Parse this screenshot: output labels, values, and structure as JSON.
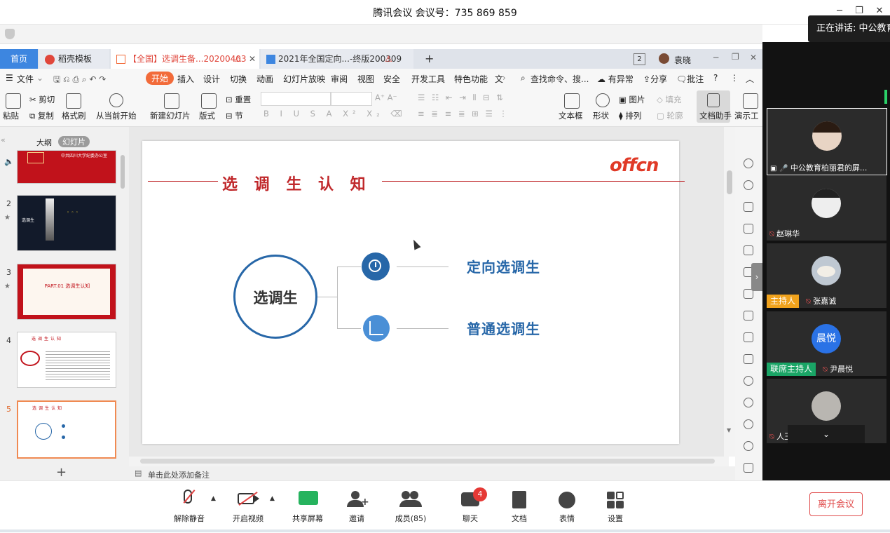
{
  "window": {
    "title": "腾讯会议 会议号：735 869 859",
    "speaking": "正在讲话: 中公教育钢"
  },
  "wps": {
    "tabs": [
      {
        "label": "首页"
      },
      {
        "label": "稻壳模板"
      },
      {
        "label": "【全国】选调生备...20200403"
      },
      {
        "label": "2021年全国定向...-终版200309"
      }
    ],
    "badge_count": "2",
    "user": "袁晓",
    "menu": [
      "文件",
      "开始",
      "插入",
      "设计",
      "切换",
      "动画",
      "幻灯片放映",
      "审阅",
      "视图",
      "安全",
      "开发工具",
      "特色功能",
      "文"
    ],
    "search_placeholder": "查找命令、搜...",
    "right_menu": [
      "有异常",
      "分享",
      "批注"
    ],
    "ribbon": {
      "paste": "粘贴",
      "cut": "剪切",
      "copy": "复制",
      "format_painter": "格式刷",
      "from_current": "从当前开始",
      "new_slide": "新建幻灯片",
      "layout": "版式",
      "reset": "重置",
      "section": "节",
      "textbox": "文本框",
      "shape": "形状",
      "picture": "图片",
      "arrange": "排列",
      "fill": "填充",
      "outline": "轮廓",
      "doc_assistant": "文档助手",
      "present": "演示工"
    }
  },
  "left_panel": {
    "tab_outline": "大纲",
    "tab_slides": "幻灯片",
    "thumbs": [
      {
        "num": "",
        "text": "中共四川大学纪委办公室"
      },
      {
        "num": "2",
        "text": "选调生"
      },
      {
        "num": "3",
        "text": "PART.01 选调生认知"
      },
      {
        "num": "4",
        "text": "选调生认知"
      },
      {
        "num": "5",
        "text": "选调生认知"
      }
    ],
    "add": "+"
  },
  "slide": {
    "title": "选 调 生 认 知",
    "logo": "offcn",
    "center": "选调生",
    "branches": [
      "定向选调生",
      "普通选调生"
    ]
  },
  "notes": {
    "placeholder": "单击此处添加备注"
  },
  "participants": [
    {
      "name": "中公教育柏丽君的屏...",
      "badge": ""
    },
    {
      "name": "赵琳华",
      "badge": ""
    },
    {
      "name": "张嘉诚",
      "badge": "主持人"
    },
    {
      "name": "尹晨悦",
      "badge": "联席主持人",
      "initials": "晨悦"
    },
    {
      "name": "人王",
      "badge": ""
    }
  ],
  "toolbar": [
    {
      "label": "解除静音"
    },
    {
      "label": "开启视频"
    },
    {
      "label": "共享屏幕"
    },
    {
      "label": "邀请"
    },
    {
      "label": "成员(85)"
    },
    {
      "label": "聊天",
      "badge": "4"
    },
    {
      "label": "文档"
    },
    {
      "label": "表情"
    },
    {
      "label": "设置"
    }
  ],
  "leave": "离开会议",
  "colors": {
    "accent_red": "#c0282b",
    "blue": "#2767a8",
    "wps_orange": "#f26b3a",
    "host_badge": "#f0a21c",
    "cohost_badge": "#1aa566"
  }
}
